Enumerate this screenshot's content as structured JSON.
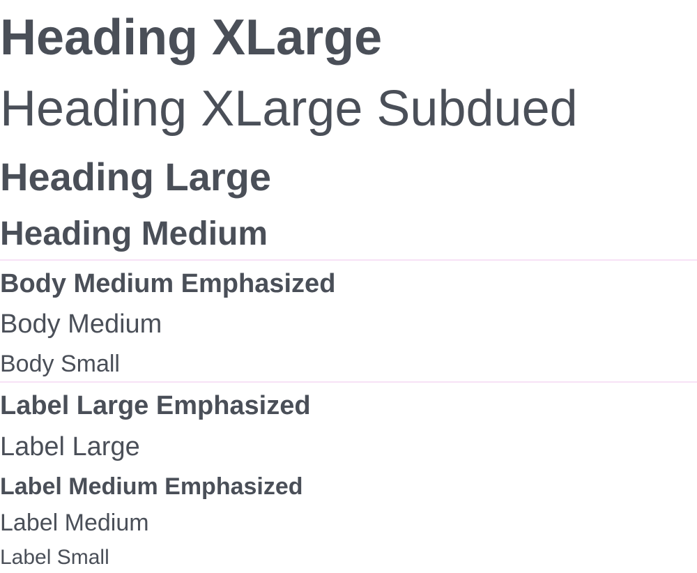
{
  "typography": {
    "heading_xlarge": "Heading XLarge",
    "heading_xlarge_subdued": "Heading XLarge Subdued",
    "heading_large": "Heading Large",
    "heading_medium": "Heading Medium",
    "body_medium_emphasized": "Body Medium Emphasized",
    "body_medium": "Body Medium",
    "body_small": "Body Small",
    "label_large_emphasized": "Label Large Emphasized",
    "label_large": "Label Large",
    "label_medium_emphasized": "Label Medium Emphasized",
    "label_medium": "Label Medium",
    "label_small": "Label Small"
  },
  "colors": {
    "text": "#4a4f58",
    "divider": "#f7e1f6",
    "background": "#ffffff"
  }
}
